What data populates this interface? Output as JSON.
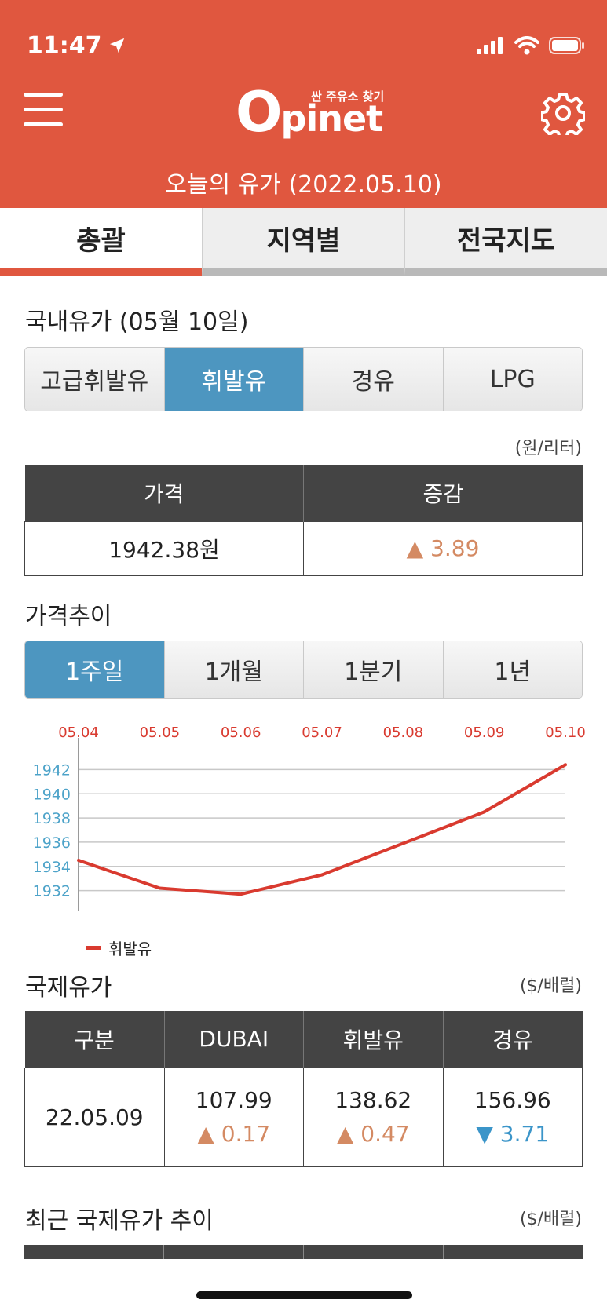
{
  "status": {
    "time": "11:47"
  },
  "header": {
    "logo_tag": "싼 주유소 찾기",
    "logo_first": "O",
    "logo_rest": "pinet",
    "subtitle": "오늘의 유가 (2022.05.10)"
  },
  "tabs": [
    {
      "label": "총괄",
      "active": true
    },
    {
      "label": "지역별",
      "active": false
    },
    {
      "label": "전국지도",
      "active": false
    }
  ],
  "domestic": {
    "title": "국내유가 (05월 10일)",
    "fuel_types": [
      "고급휘발유",
      "휘발유",
      "경유",
      "LPG"
    ],
    "selected_fuel": "휘발유",
    "unit": "(원/리터)",
    "headers": [
      "가격",
      "증감"
    ],
    "price": "1942.38원",
    "change": "▲ 3.89"
  },
  "trend": {
    "title": "가격추이",
    "periods": [
      "1주일",
      "1개월",
      "1분기",
      "1년"
    ],
    "selected_period": "1주일"
  },
  "chart_data": {
    "type": "line",
    "x": [
      "05.04",
      "05.05",
      "05.06",
      "05.07",
      "05.08",
      "05.09",
      "05.10"
    ],
    "yticks": [
      1932,
      1934,
      1936,
      1938,
      1940,
      1942
    ],
    "ylim": [
      1931,
      1943
    ],
    "series": [
      {
        "name": "휘발유",
        "color": "#d93a2f",
        "values": [
          1934.5,
          1932.2,
          1931.7,
          1933.3,
          1935.9,
          1938.5,
          1942.4
        ]
      }
    ],
    "legend": "bottom-left",
    "grid": true
  },
  "international": {
    "title": "국제유가",
    "unit": "($/배럴)",
    "headers": [
      "구분",
      "DUBAI",
      "휘발유",
      "경유"
    ],
    "date": "22.05.09",
    "values": [
      "107.99",
      "138.62",
      "156.96"
    ],
    "changes": [
      {
        "text": "▲ 0.17",
        "dir": "up"
      },
      {
        "text": "▲ 0.47",
        "dir": "up"
      },
      {
        "text": "▼ 3.71",
        "dir": "down"
      }
    ]
  },
  "recent": {
    "title": "최근 국제유가 추이",
    "unit": "($/배럴)"
  },
  "colors": {
    "brand": "#e0573f",
    "accent_blue": "#4d96c0",
    "up": "#d48a63",
    "down": "#3b95c9"
  }
}
